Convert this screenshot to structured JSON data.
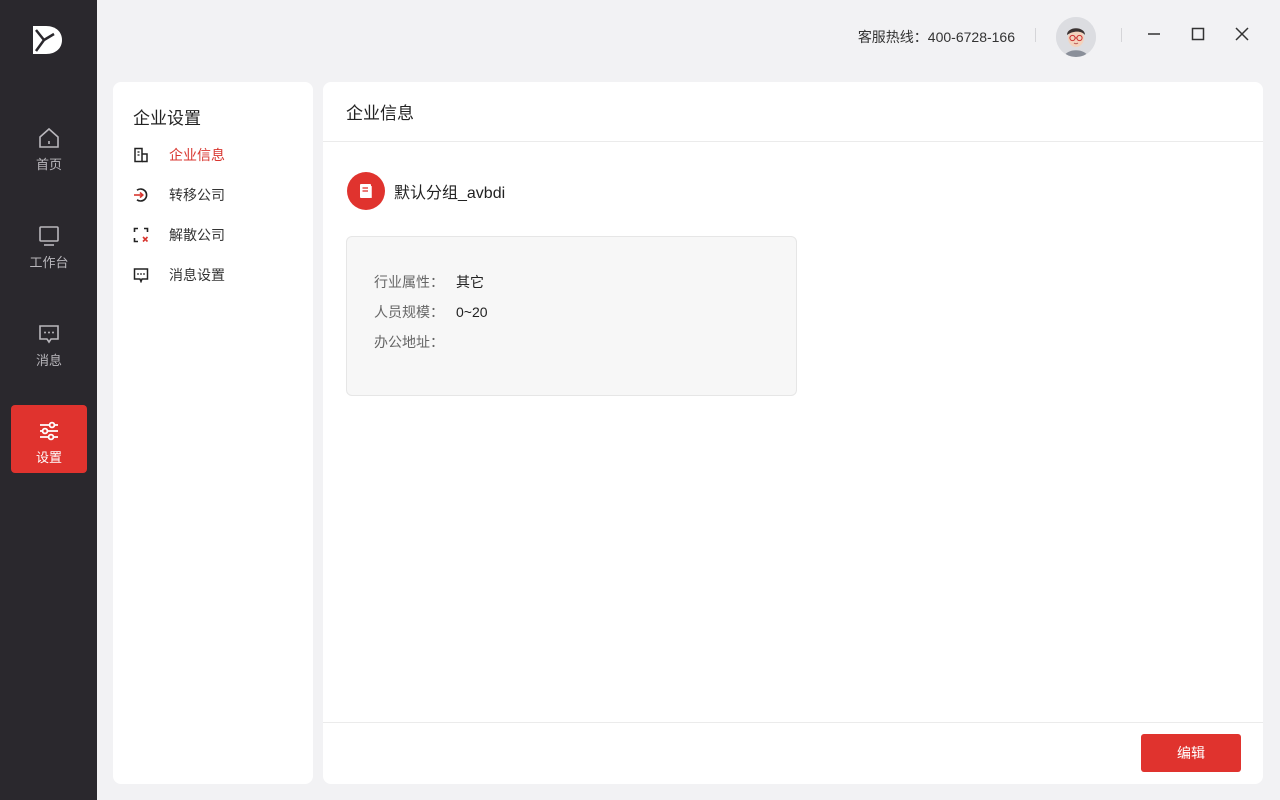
{
  "nav": {
    "items": [
      {
        "label": "首页",
        "icon": "home-icon"
      },
      {
        "label": "工作台",
        "icon": "monitor-icon"
      },
      {
        "label": "消息",
        "icon": "message-icon"
      },
      {
        "label": "设置",
        "icon": "sliders-icon",
        "active": true
      }
    ]
  },
  "topbar": {
    "hotline": "客服热线：400-6728-166"
  },
  "subnav": {
    "title": "企业设置",
    "items": [
      {
        "label": "企业信息",
        "icon": "company-doc-icon",
        "active": true
      },
      {
        "label": "转移公司",
        "icon": "transfer-icon"
      },
      {
        "label": "解散公司",
        "icon": "dissolve-icon"
      },
      {
        "label": "消息设置",
        "icon": "message-settings-icon"
      }
    ]
  },
  "main": {
    "title": "企业信息",
    "company_name": "默认分组_avbdi",
    "info": [
      {
        "key": "行业属性：",
        "value": "其它"
      },
      {
        "key": "人员规模：",
        "value": "0~20"
      },
      {
        "key": "办公地址：",
        "value": ""
      }
    ],
    "edit_label": "编辑"
  },
  "colors": {
    "accent": "#e0332e",
    "rail": "#2a282d",
    "background": "#f2f2f4"
  }
}
